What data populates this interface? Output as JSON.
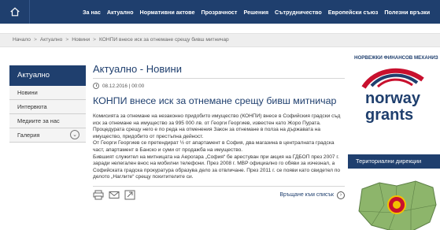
{
  "nav": {
    "items": [
      "За нас",
      "Актуално",
      "Нормативни актове",
      "Прозрачност",
      "Решения",
      "Сътрудничество",
      "Европейски съюз",
      "Полезни връзки"
    ]
  },
  "breadcrumb": {
    "items": [
      "Начало",
      "Актуално",
      "Новини",
      "КОНПИ внесе иск за отнемане срещу бивш митничар"
    ],
    "separator": ">"
  },
  "sidebar": {
    "heading": "Актуално",
    "items": [
      "Новини",
      "Интервюта",
      "Медиите за нас",
      "Галерия"
    ]
  },
  "main": {
    "page_title": "Актуално - Новини",
    "date": "08.12.2016 | 00:00",
    "article_title": "КОНПИ внесе иск за отнемане срещу бивш митничар",
    "paragraphs": [
      "Комисията за отнемане на незаконно придобито имущество (КОНПИ) внесе в Софийския градски съд иск за отнемане на имущество за 995 000 лв. от Георги Георгиев, известен като Жоро Пурата. Процедурата срещу него е по реда на отменения Закон за отнемане в полза на държавата на имущество, придобито от престъпна дейност.",
      "От Георги Георгиев се претендират ½ от апартамент в София, два магазина в централната градска част, апартамент в Банско и суми от продажба на имущество.",
      "Бившият служител на митницата на Аерогара „София“ бе арестуван при акция на ГДБОП през 2007 г. заради нелегален внос на мобилни телефони. През 2008 г. МВР официално го обяви за изчезнал, а Софийската градска прокуратура образува дело за отвличане. През 2011 г. се появи като свидетел по делото „Наглите“ срещу похитителите си."
    ],
    "back_link": "Връщане към списък"
  },
  "right": {
    "norway_label": "НОРВЕЖКИ ФИНАНСОВ МЕХАНИЗ",
    "logo_line1": "norway",
    "logo_line2": "grants",
    "regional_heading": "Териториални дирекции"
  },
  "icons": {
    "home": "home-icon",
    "clock": "clock-icon",
    "print": "print-icon",
    "email": "email-icon",
    "share": "share-icon",
    "back": "chevron-right-icon",
    "expand": "chevron-down-icon"
  },
  "colors": {
    "brand": "#1f3f6e",
    "logo_red": "#c8102e",
    "map_green": "#8db56b"
  }
}
